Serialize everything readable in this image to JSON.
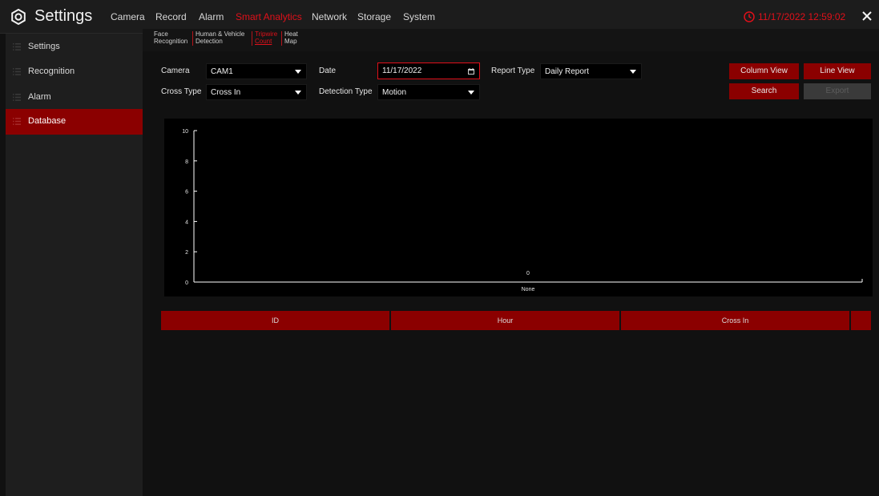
{
  "header": {
    "title": "Settings",
    "menu": [
      "Camera",
      "Record",
      "Alarm",
      "Smart Analytics",
      "Network",
      "Storage",
      "System"
    ],
    "active_menu": "Smart Analytics",
    "datetime": "11/17/2022 12:59:02",
    "icons": {
      "logo": "settings-gear-icon",
      "clock": "clock-icon",
      "close": "close-icon"
    },
    "colors": {
      "accent": "#e0101a",
      "active_bg": "#8b0000"
    }
  },
  "sidebar": {
    "items": [
      {
        "label": "Settings",
        "icon": "menu-lines-icon"
      },
      {
        "label": "Recognition",
        "icon": "menu-lines-icon"
      },
      {
        "label": "Alarm",
        "icon": "menu-lines-icon"
      },
      {
        "label": "Database",
        "icon": "menu-lines-icon",
        "active": true
      }
    ]
  },
  "subtabs": [
    {
      "line1": "Face",
      "line2": "Recognition"
    },
    {
      "line1": "Human & Vehicle",
      "line2": "Detection"
    },
    {
      "line1": "Tripwire",
      "line2": "Count",
      "active": true
    },
    {
      "line1": "Heat",
      "line2": "Map"
    }
  ],
  "form": {
    "camera_label": "Camera",
    "camera_value": "CAM1",
    "date_label": "Date",
    "date_value": "11/17/2022",
    "report_type_label": "Report Type",
    "report_type_value": "Daily Report",
    "cross_type_label": "Cross Type",
    "cross_type_value": "Cross In",
    "detection_type_label": "Detection Type",
    "detection_type_value": "Motion"
  },
  "buttons": {
    "column_view": "Column View",
    "line_view": "Line View",
    "search": "Search",
    "export": "Export"
  },
  "chart_data": {
    "type": "bar",
    "categories": [
      "None"
    ],
    "values": [
      0
    ],
    "data_labels": [
      "0"
    ],
    "ylim": [
      0,
      10
    ],
    "yticks": [
      "0",
      "2",
      "4",
      "6",
      "8",
      "10"
    ],
    "title": "",
    "xlabel": "",
    "ylabel": "",
    "grid": false
  },
  "table": {
    "columns": [
      "ID",
      "Hour",
      "Cross In",
      ""
    ],
    "rows": []
  }
}
